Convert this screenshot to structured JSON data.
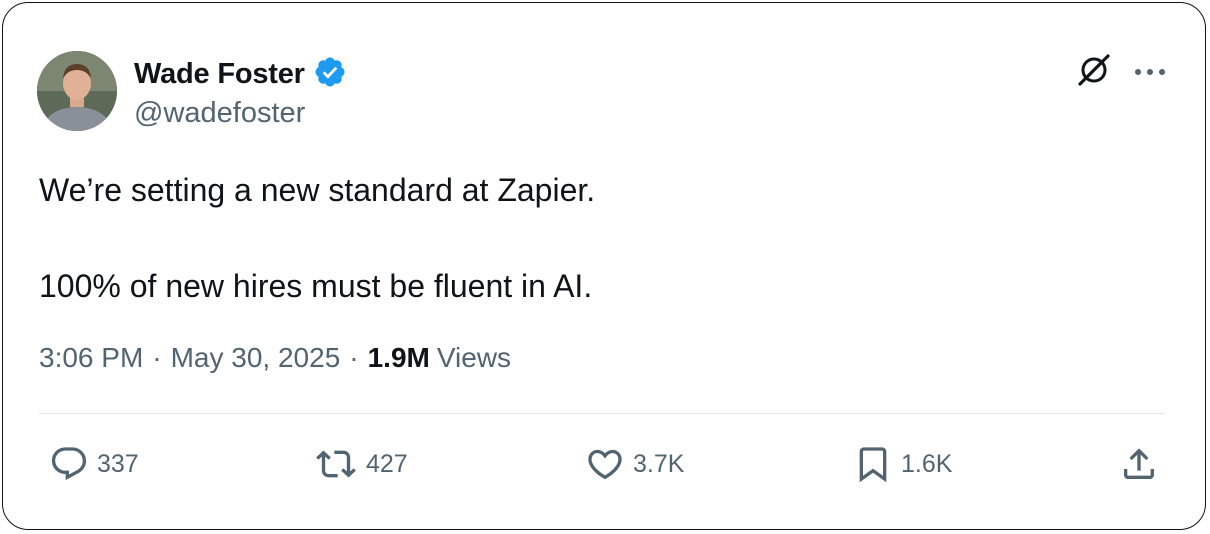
{
  "author": {
    "name": "Wade Foster",
    "handle": "@wadefoster",
    "verified": true,
    "verified_color": "#1d9bf0",
    "avatar_icon": "profile-photo"
  },
  "top_icons": [
    "grok-icon",
    "more-options-icon"
  ],
  "tweet": {
    "lines": [
      "We’re setting a new standard at Zapier.",
      "100% of new hires must be fluent in AI."
    ]
  },
  "meta": {
    "time": "3:06 PM",
    "separator": "·",
    "date": "May 30, 2025",
    "views_count": "1.9M",
    "views_label": "Views"
  },
  "actions": {
    "replies": "337",
    "reposts": "427",
    "likes": "3.7K",
    "bookmarks": "1.6K"
  },
  "colors": {
    "text": "#0f1419",
    "secondary": "#536471",
    "divider": "#e1e5e8"
  }
}
